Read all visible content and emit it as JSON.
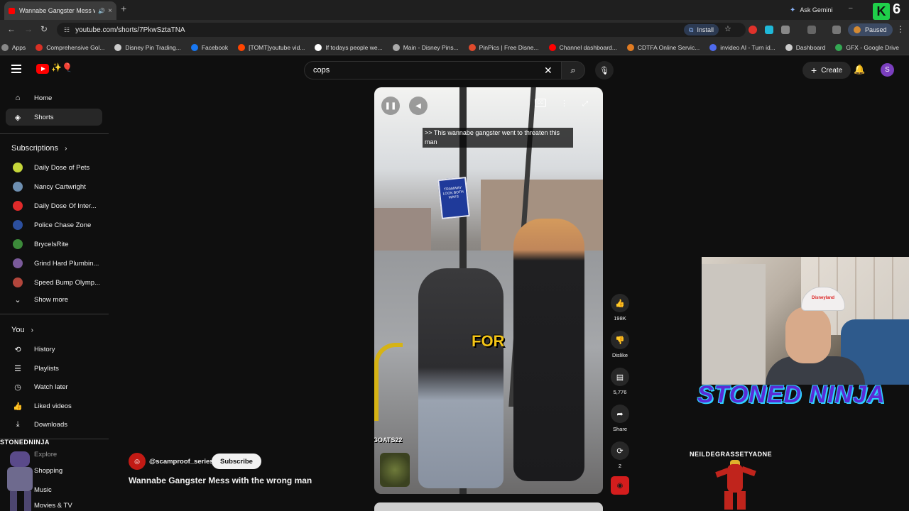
{
  "browser": {
    "tab_title": "Wannabe Gangster Mess w",
    "tab_close": "×",
    "new_tab": "+",
    "ask_gemini": "Ask Gemini",
    "url": "youtube.com/shorts/7PkwSztaTNA",
    "install_label": "Install",
    "profile_status": "Paused",
    "badge_letter": "K",
    "badge_number": "6",
    "nav": {
      "back": "←",
      "forward": "→",
      "reload": "↻"
    },
    "bookmarks": [
      {
        "label": "Apps",
        "color": "#888888"
      },
      {
        "label": "Comprehensive Gol...",
        "color": "#d93025"
      },
      {
        "label": "Disney Pin Trading...",
        "color": "#cccccc"
      },
      {
        "label": "Facebook",
        "color": "#1877f2"
      },
      {
        "label": "[TOMT]youtube vid...",
        "color": "#ff4500"
      },
      {
        "label": "If todays people we...",
        "color": "#ffffff"
      },
      {
        "label": "Main - Disney Pins...",
        "color": "#aaaaaa"
      },
      {
        "label": "PinPics | Free Disne...",
        "color": "#e04a2c"
      },
      {
        "label": "Channel dashboard...",
        "color": "#ff0000"
      },
      {
        "label": "CDTFA Online Servic...",
        "color": "#e07b22"
      },
      {
        "label": "invideo AI - Turn id...",
        "color": "#4f6bed"
      },
      {
        "label": "Dashboard",
        "color": "#cccccc"
      },
      {
        "label": "GFX - Google Drive",
        "color": "#34a853"
      }
    ]
  },
  "youtube": {
    "search_value": "cops",
    "clear_symbol": "✕",
    "search_symbol": "⌕",
    "mic_symbol": "🎙",
    "create_label": "Create",
    "create_plus": "+",
    "bell_symbol": "🔔",
    "avatar_letter": "S",
    "sidebar": {
      "home": "Home",
      "shorts": "Shorts",
      "subscriptions_header": "Subscriptions",
      "subscriptions": [
        {
          "name": "Daily Dose of Pets",
          "color": "#c5d63a"
        },
        {
          "name": "Nancy Cartwright",
          "color": "#6e8fb0"
        },
        {
          "name": "Daily Dose Of Inter...",
          "color": "#e02a2a"
        },
        {
          "name": "Police Chase Zone",
          "color": "#2c4f9e"
        },
        {
          "name": "BryceIsRite",
          "color": "#3c8a3a"
        },
        {
          "name": "Grind Hard Plumbin...",
          "color": "#7a5a9a"
        },
        {
          "name": "Speed Bump Olymp...",
          "color": "#b2463c"
        }
      ],
      "show_more": "Show more",
      "you_header": "You",
      "you_items": [
        "History",
        "Playlists",
        "Watch later",
        "Liked videos",
        "Downloads"
      ],
      "explore_items": [
        "Explore",
        "Shopping",
        "Music",
        "Movies & TV"
      ]
    },
    "video": {
      "caption": ">> This wannabe gangster went to threaten this man",
      "overlay_word": "FOR",
      "watermark": "GOATS22",
      "sign_text": "TRAMWAY LOOK BOTH WAYS",
      "cc_label": "CC"
    },
    "actions": {
      "likes": "198K",
      "dislike_label": "Dislike",
      "comments": "5,776",
      "share_label": "Share",
      "remix_count": "2"
    },
    "channel": {
      "handle": "@scamproof_series",
      "subscribe": "Subscribe",
      "title": "Wannabe Gangster Mess with the wrong man"
    }
  },
  "overlay": {
    "streamer_name": "STONED NINJA",
    "cap_text": "Disneyland",
    "neil_tag": "NEILDEGRASSETYADNE",
    "left_tag": "STONEDNINJA"
  }
}
